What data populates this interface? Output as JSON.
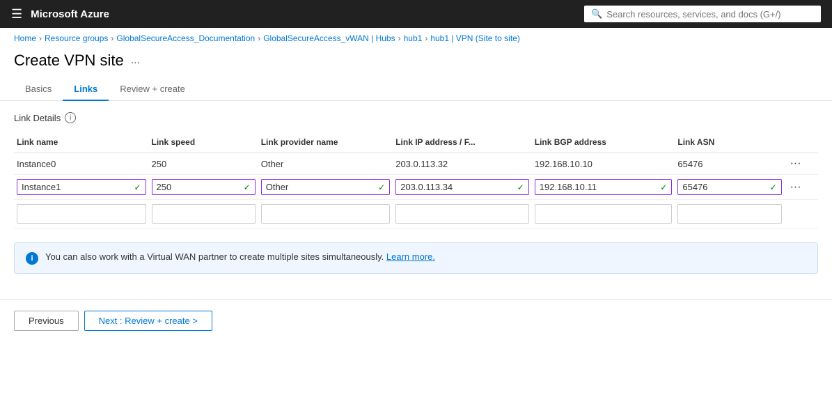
{
  "topbar": {
    "hamburger": "☰",
    "title": "Microsoft Azure",
    "search_placeholder": "Search resources, services, and docs (G+/)"
  },
  "breadcrumb": {
    "items": [
      {
        "label": "Home",
        "href": "#"
      },
      {
        "label": "Resource groups",
        "href": "#"
      },
      {
        "label": "GlobalSecureAccess_Documentation",
        "href": "#"
      },
      {
        "label": "GlobalSecureAccess_vWAN | Hubs",
        "href": "#"
      },
      {
        "label": "hub1",
        "href": "#"
      },
      {
        "label": "hub1 | VPN (Site to site)",
        "href": "#"
      }
    ]
  },
  "page": {
    "title": "Create VPN site",
    "more": "..."
  },
  "tabs": [
    {
      "label": "Basics",
      "active": false
    },
    {
      "label": "Links",
      "active": true
    },
    {
      "label": "Review + create",
      "active": false
    }
  ],
  "section": {
    "label": "Link Details"
  },
  "table": {
    "columns": [
      "Link name",
      "Link speed",
      "Link provider name",
      "Link IP address / F...",
      "Link BGP address",
      "Link ASN"
    ],
    "rows": [
      {
        "name": "Instance0",
        "speed": "250",
        "provider": "Other",
        "ip": "203.0.113.32",
        "bgp": "192.168.10.10",
        "asn": "65476",
        "editable": false
      },
      {
        "name": "Instance1",
        "speed": "250",
        "provider": "Other",
        "ip": "203.0.113.34",
        "bgp": "192.168.10.11",
        "asn": "65476",
        "editable": true
      },
      {
        "name": "",
        "speed": "",
        "provider": "",
        "ip": "",
        "bgp": "",
        "asn": "",
        "editable": true,
        "empty": true
      }
    ]
  },
  "info_banner": {
    "text": "You can also work with a Virtual WAN partner to create multiple sites simultaneously.",
    "link_text": "Learn more."
  },
  "footer": {
    "previous_label": "Previous",
    "next_label": "Next : Review + create >"
  }
}
